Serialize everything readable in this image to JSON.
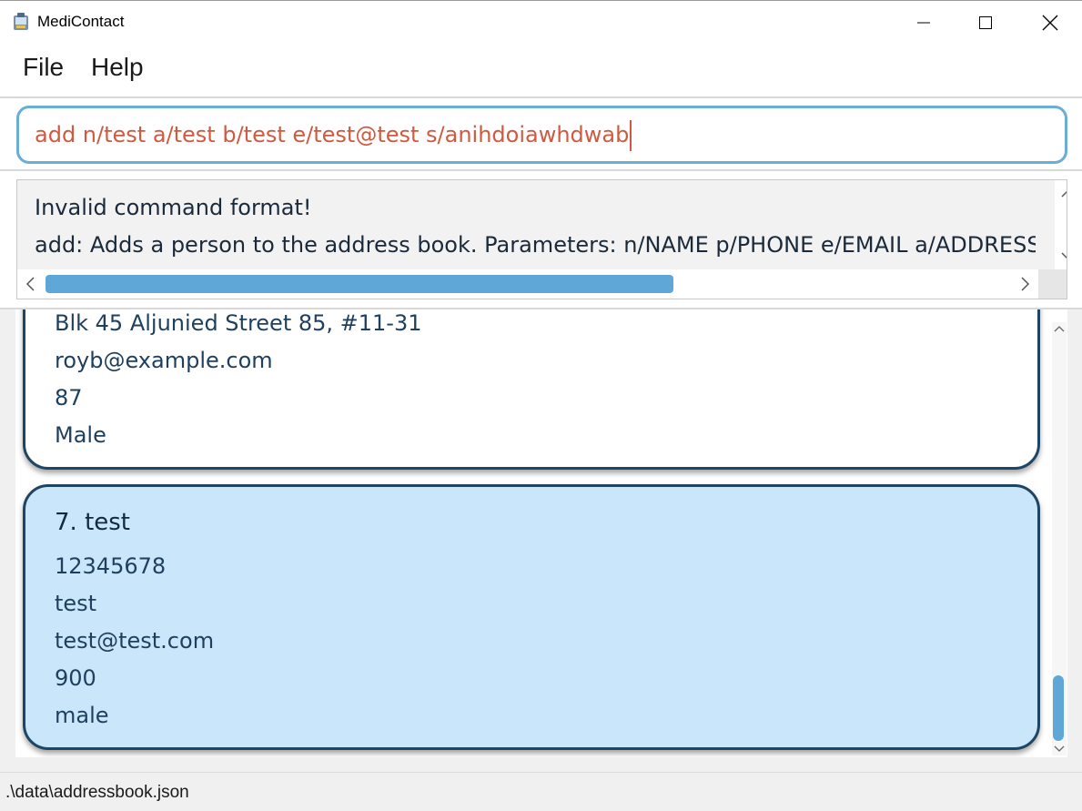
{
  "window": {
    "title": "MediContact"
  },
  "menu": {
    "file": "File",
    "help": "Help"
  },
  "command": {
    "value": "add n/test a/test b/test e/test@test s/anihdoiawhdwab"
  },
  "result": {
    "line1": "Invalid command format!",
    "line2": "add: Adds a person to the address book. Parameters: n/NAME p/PHONE e/EMAIL a/ADDRESS"
  },
  "persons": [
    {
      "address": "Blk 45 Aljunied Street 85, #11-31",
      "email": "royb@example.com",
      "age": "87",
      "sex": "Male"
    },
    {
      "title": "7. test",
      "phone": "12345678",
      "address": "test",
      "email": "test@test.com",
      "age": "900",
      "sex": "male"
    }
  ],
  "status": {
    "path": ".\\data\\addressbook.json"
  },
  "colors": {
    "accent": "#5ea7d6",
    "selected_card": "#c9e6fa",
    "card_border": "#1f4564",
    "error_text": "#d05a3f"
  }
}
